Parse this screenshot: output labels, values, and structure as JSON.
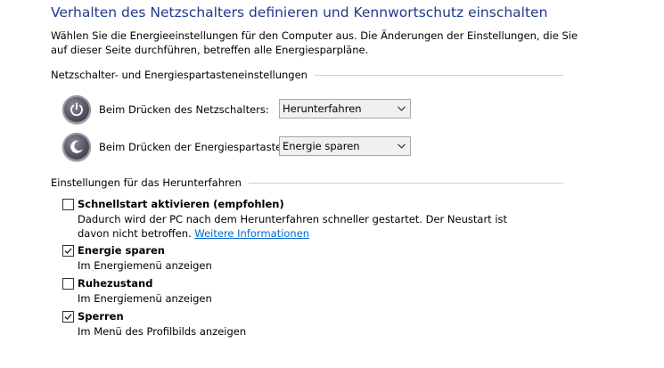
{
  "header": {
    "title": "Verhalten des Netzschalters definieren und Kennwortschutz einschalten",
    "description": "Wählen Sie die Energieeinstellungen für den Computer aus. Die Änderungen der Einstellungen, die Sie auf dieser Seite durchführen, betreffen alle Energiesparpläne."
  },
  "power_section": {
    "heading": "Netzschalter- und Energiespartasteneinstellungen",
    "rows": [
      {
        "label": "Beim Drücken des Netzschalters:",
        "value": "Herunterfahren",
        "icon": "power-button-icon"
      },
      {
        "label": "Beim Drücken der Energiespartaste:",
        "value": "Energie sparen",
        "icon": "sleep-button-icon"
      }
    ]
  },
  "shutdown_section": {
    "heading": "Einstellungen für das Herunterfahren",
    "items": [
      {
        "title": "Schnellstart aktivieren (empfohlen)",
        "description": "Dadurch wird der PC nach dem Herunterfahren schneller gestartet. Der Neustart ist davon nicht betroffen.",
        "link": "Weitere Informationen",
        "checked": false
      },
      {
        "title": "Energie sparen",
        "description": "Im Energiemenü anzeigen",
        "checked": true
      },
      {
        "title": "Ruhezustand",
        "description": "Im Energiemenü anzeigen",
        "checked": false
      },
      {
        "title": "Sperren",
        "description": "Im Menü des Profilbilds anzeigen",
        "checked": true
      }
    ]
  },
  "colors": {
    "title": "#1e3a8a",
    "link": "#0066cc"
  }
}
